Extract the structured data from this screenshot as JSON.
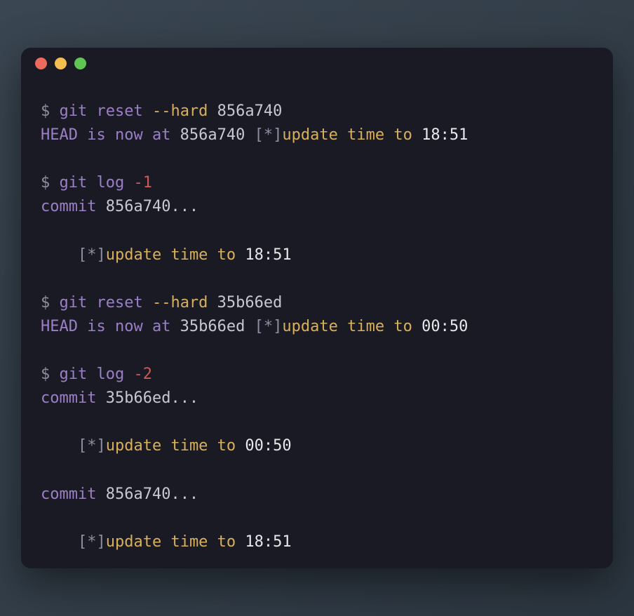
{
  "titlebar": {
    "buttons": [
      "close",
      "minimize",
      "maximize"
    ]
  },
  "terminal": {
    "lines": [
      {
        "segments": [
          {
            "cls": "prompt",
            "text": "$ "
          },
          {
            "cls": "purple",
            "text": "git reset "
          },
          {
            "cls": "yellow-txt",
            "text": "--hard"
          },
          {
            "cls": "lightgray",
            "text": " 856a740"
          }
        ]
      },
      {
        "segments": [
          {
            "cls": "purple",
            "text": "HEAD is now at"
          },
          {
            "cls": "lightgray",
            "text": " 856a740 "
          },
          {
            "cls": "gray-dim",
            "text": "[*]"
          },
          {
            "cls": "yellow-txt",
            "text": "update time to"
          },
          {
            "cls": "white",
            "text": " 18:51"
          }
        ]
      },
      {
        "segments": [
          {
            "cls": "",
            "text": ""
          }
        ]
      },
      {
        "segments": [
          {
            "cls": "prompt",
            "text": "$ "
          },
          {
            "cls": "purple",
            "text": "git log "
          },
          {
            "cls": "red-txt",
            "text": "-1"
          }
        ]
      },
      {
        "segments": [
          {
            "cls": "purple",
            "text": "commit"
          },
          {
            "cls": "lightgray",
            "text": " 856a740..."
          }
        ]
      },
      {
        "segments": [
          {
            "cls": "",
            "text": ""
          }
        ]
      },
      {
        "segments": [
          {
            "cls": "",
            "text": "    "
          },
          {
            "cls": "gray-dim",
            "text": "[*]"
          },
          {
            "cls": "yellow-txt",
            "text": "update time to"
          },
          {
            "cls": "white",
            "text": " 18:51"
          }
        ]
      },
      {
        "segments": [
          {
            "cls": "",
            "text": ""
          }
        ]
      },
      {
        "segments": [
          {
            "cls": "prompt",
            "text": "$ "
          },
          {
            "cls": "purple",
            "text": "git reset "
          },
          {
            "cls": "yellow-txt",
            "text": "--hard"
          },
          {
            "cls": "lightgray",
            "text": " 35b66ed"
          }
        ]
      },
      {
        "segments": [
          {
            "cls": "purple",
            "text": "HEAD is now at"
          },
          {
            "cls": "lightgray",
            "text": " 35b66ed "
          },
          {
            "cls": "gray-dim",
            "text": "[*]"
          },
          {
            "cls": "yellow-txt",
            "text": "update time to"
          },
          {
            "cls": "white",
            "text": " 00:50"
          }
        ]
      },
      {
        "segments": [
          {
            "cls": "",
            "text": ""
          }
        ]
      },
      {
        "segments": [
          {
            "cls": "prompt",
            "text": "$ "
          },
          {
            "cls": "purple",
            "text": "git log "
          },
          {
            "cls": "red-txt",
            "text": "-2"
          }
        ]
      },
      {
        "segments": [
          {
            "cls": "purple",
            "text": "commit"
          },
          {
            "cls": "lightgray",
            "text": " 35b66ed..."
          }
        ]
      },
      {
        "segments": [
          {
            "cls": "",
            "text": ""
          }
        ]
      },
      {
        "segments": [
          {
            "cls": "",
            "text": "    "
          },
          {
            "cls": "gray-dim",
            "text": "[*]"
          },
          {
            "cls": "yellow-txt",
            "text": "update time to"
          },
          {
            "cls": "white",
            "text": " 00:50"
          }
        ]
      },
      {
        "segments": [
          {
            "cls": "",
            "text": ""
          }
        ]
      },
      {
        "segments": [
          {
            "cls": "purple",
            "text": "commit"
          },
          {
            "cls": "lightgray",
            "text": " 856a740..."
          }
        ]
      },
      {
        "segments": [
          {
            "cls": "",
            "text": ""
          }
        ]
      },
      {
        "segments": [
          {
            "cls": "",
            "text": "    "
          },
          {
            "cls": "gray-dim",
            "text": "[*]"
          },
          {
            "cls": "yellow-txt",
            "text": "update time to"
          },
          {
            "cls": "white",
            "text": " 18:51"
          }
        ]
      }
    ]
  }
}
